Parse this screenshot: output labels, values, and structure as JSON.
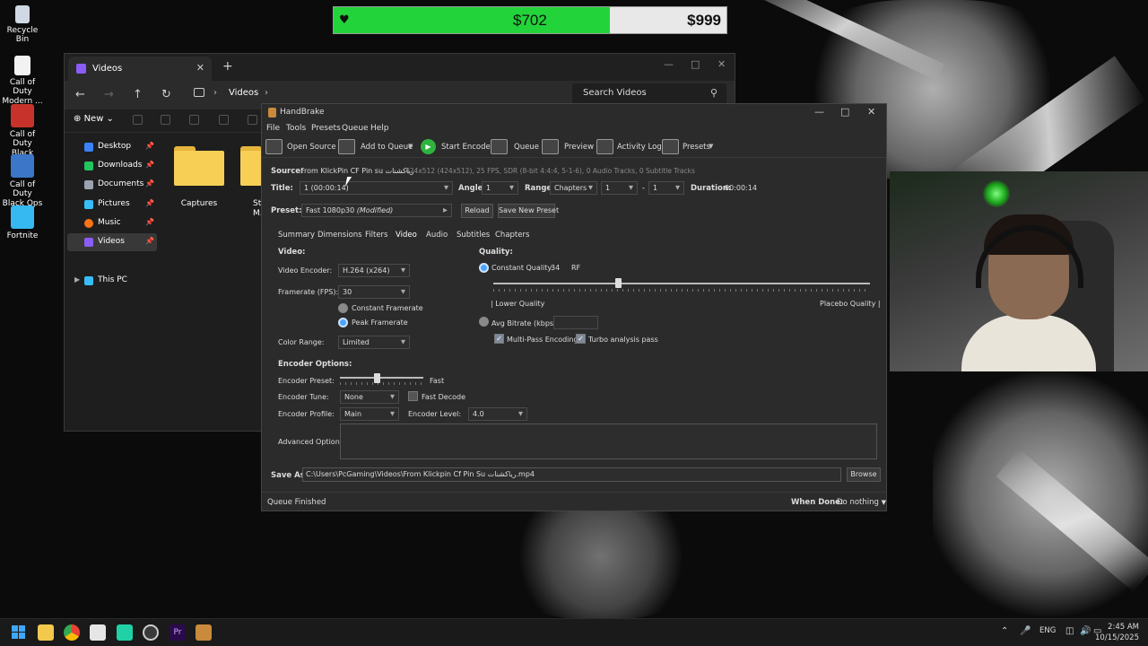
{
  "desktop": {
    "icons": [
      {
        "label": "Recycle Bin",
        "color": "#cfd8e3"
      },
      {
        "label": "Call of Duty Modern ...",
        "color": "#f2f2f2"
      },
      {
        "label": "Call of Duty Black Ops...",
        "color": "#c7332b"
      },
      {
        "label": "Call of Duty Black Ops",
        "color": "#3b76c9"
      },
      {
        "label": "Fortnite",
        "color": "#35b9f0"
      }
    ]
  },
  "donation": {
    "current": "$702",
    "goal": "$999",
    "progress": 0.703,
    "fill_color": "#22d43a"
  },
  "explorer": {
    "tab_title": "Videos",
    "breadcrumb": [
      "Videos"
    ],
    "search_placeholder": "Search Videos",
    "new_label": "New",
    "sidebar": [
      {
        "label": "Desktop",
        "color": "#3b82f6"
      },
      {
        "label": "Downloads",
        "color": "#22c55e"
      },
      {
        "label": "Documents",
        "color": "#9ca3af"
      },
      {
        "label": "Pictures",
        "color": "#38bdf8"
      },
      {
        "label": "Music",
        "color": "#f97316"
      },
      {
        "label": "Videos",
        "color": "#8b5cf6"
      }
    ],
    "this_pc": "This PC",
    "folders": [
      {
        "label": "Captures"
      },
      {
        "label": "St... M..."
      }
    ]
  },
  "handbrake": {
    "title": "HandBrake",
    "menu": [
      "File",
      "Tools",
      "Presets",
      "Queue",
      "Help"
    ],
    "toolbar": {
      "open_source": "Open Source",
      "add_to_queue": "Add to Queue",
      "start_encode": "Start Encode",
      "queue": "Queue",
      "preview": "Preview",
      "activity_log": "Activity Log",
      "presets": "Presets"
    },
    "source": {
      "label": "Source:",
      "name": "From KlickPin CF Pin su رياكشنات",
      "info": "424x512 (424x512), 25 FPS, SDR (8-bit 4:4:4, 5-1-6), 0 Audio Tracks, 0 Subtitle Tracks"
    },
    "title_row": {
      "title_label": "Title:",
      "title_value": "1 (00:00:14)",
      "angle_label": "Angle:",
      "angle_value": "1",
      "range_label": "Range:",
      "range_type": "Chapters",
      "range_start": "1",
      "range_sep": "-",
      "range_end": "1",
      "duration_label": "Duration:",
      "duration_value": "00:00:14"
    },
    "preset": {
      "label": "Preset:",
      "value": "Fast 1080p30",
      "modified": "(Modified)",
      "reload": "Reload",
      "save_new": "Save New Preset"
    },
    "tabs": [
      "Summary",
      "Dimensions",
      "Filters",
      "Video",
      "Audio",
      "Subtitles",
      "Chapters"
    ],
    "active_tab": "Video",
    "video": {
      "section": "Video:",
      "encoder_label": "Video Encoder:",
      "encoder_value": "H.264 (x264)",
      "framerate_label": "Framerate (FPS):",
      "framerate_value": "30",
      "constant_framerate": "Constant Framerate",
      "peak_framerate": "Peak Framerate",
      "color_range_label": "Color Range:",
      "color_range_value": "Limited"
    },
    "quality": {
      "section": "Quality:",
      "constant_quality": "Constant Quality:",
      "cq_value": "34",
      "rf": "RF",
      "cq_position": 0.33,
      "lower": "| Lower Quality",
      "placebo": "Placebo Quality |",
      "avg_bitrate": "Avg Bitrate (kbps):",
      "multipass": "Multi-Pass Encoding",
      "turbo": "Turbo analysis pass"
    },
    "encoder_options": {
      "section": "Encoder Options:",
      "preset_label": "Encoder Preset:",
      "preset_value": "Fast",
      "preset_position": 0.44,
      "tune_label": "Encoder Tune:",
      "tune_value": "None",
      "fast_decode": "Fast Decode",
      "profile_label": "Encoder Profile:",
      "profile_value": "Main",
      "level_label": "Encoder Level:",
      "level_value": "4.0",
      "advanced_label": "Advanced Options:"
    },
    "save": {
      "label": "Save As:",
      "path": "C:\\Users\\PcGaming\\Videos\\From Klickpin Cf Pin Su رياكشنات.mp4",
      "browse": "Browse"
    },
    "status": {
      "left": "Queue Finished",
      "when_done_label": "When Done:",
      "when_done_value": "Do nothing"
    }
  },
  "taskbar": {
    "lang": "ENG",
    "time": "2:45 AM",
    "date": "10/15/2025"
  }
}
